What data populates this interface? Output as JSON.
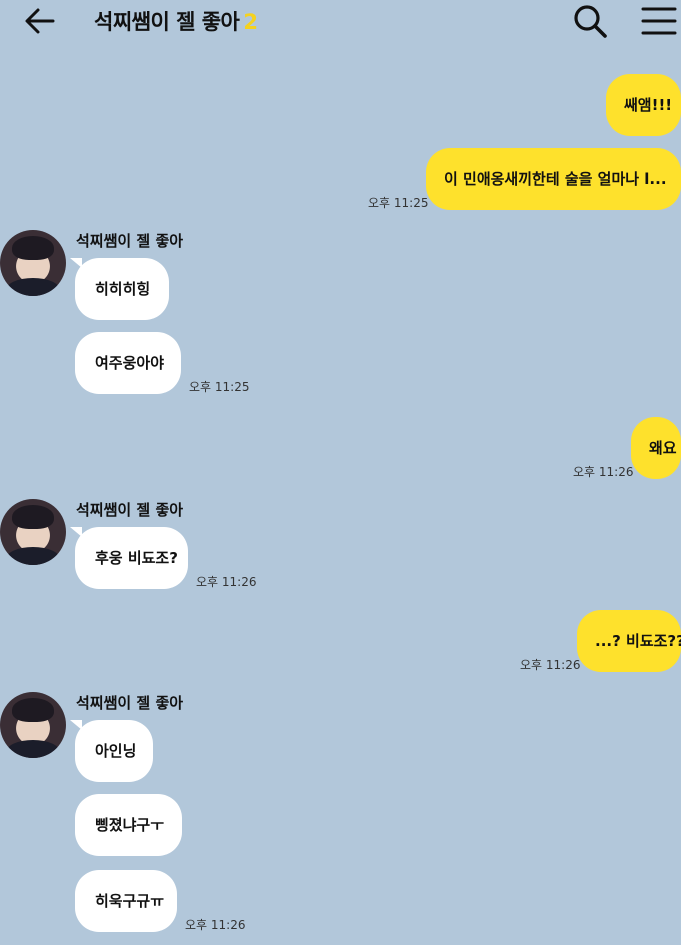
{
  "header": {
    "title": "석찌쌤이 젤 좋아",
    "member_count": "2",
    "back_icon": "arrow-left-icon",
    "search_icon": "search-icon",
    "menu_icon": "hamburger-menu-icon"
  },
  "colors": {
    "background": "#b2c7da",
    "my_bubble": "#fee12c",
    "their_bubble": "#ffffff",
    "count_accent": "#f5d21f"
  },
  "messages": {
    "m1": {
      "text": "쌔앰!!!"
    },
    "m2": {
      "text": "이 민애옹새끼한테 술을 얼마나 l...",
      "time": "오후 11:25"
    },
    "g1": {
      "sender": "석찌쌤이 젤 좋아"
    },
    "m3": {
      "text": "히히히힝"
    },
    "m4": {
      "text": "여주웅아야",
      "time": "오후 11:25"
    },
    "m5": {
      "text": "왜요",
      "time": "오후 11:26"
    },
    "g2": {
      "sender": "석찌쌤이 젤 좋아"
    },
    "m6": {
      "text": "후웅 비됴조?",
      "time": "오후 11:26"
    },
    "m7": {
      "text": "...? 비됴조??",
      "time": "오후 11:26"
    },
    "g3": {
      "sender": "석찌쌤이 젤 좋아"
    },
    "m8": {
      "text": "아인닝"
    },
    "m9": {
      "text": "삥졌냐구ㅜ"
    },
    "m10": {
      "text": "히욱구규ㅠ",
      "time": "오후 11:26"
    }
  }
}
